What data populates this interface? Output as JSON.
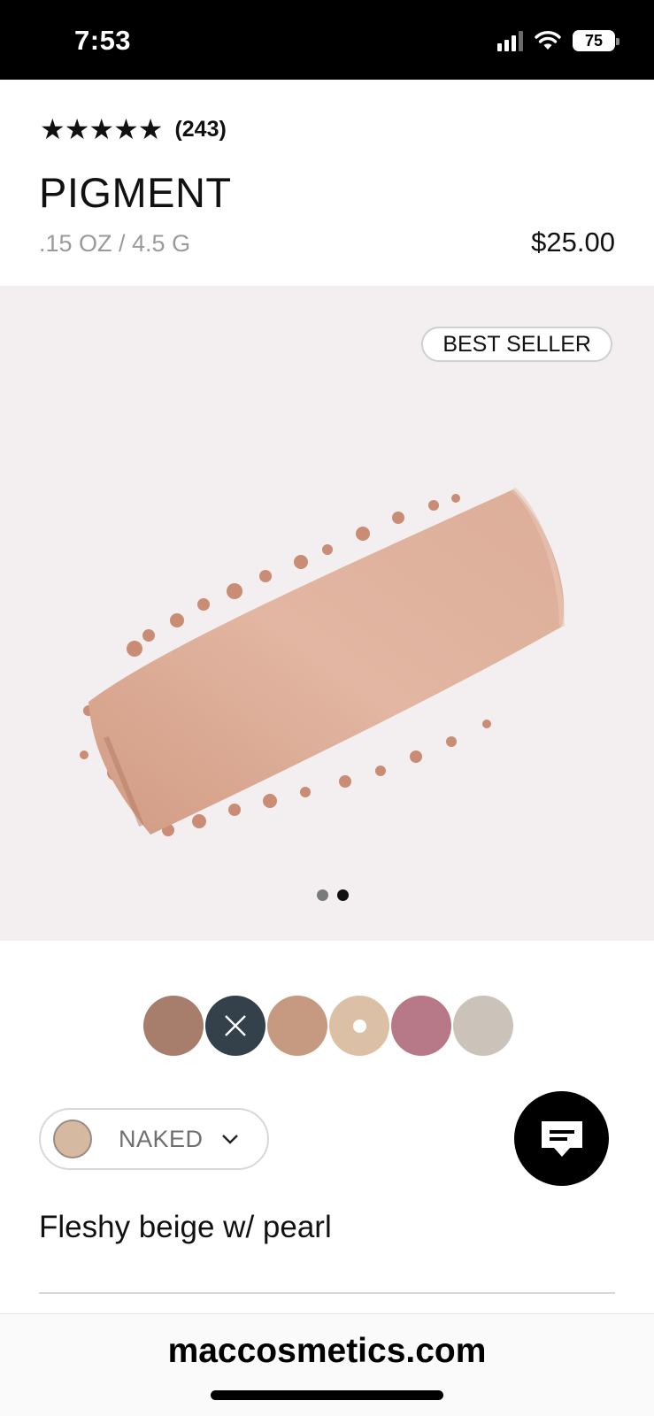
{
  "status_bar": {
    "time": "7:53",
    "battery": "75"
  },
  "product": {
    "stars": "★★★★★",
    "review_count": "(243)",
    "title": "PIGMENT",
    "size": ".15 OZ / 4.5 G",
    "price": "$25.00",
    "badge": "BEST SELLER"
  },
  "carousel": {
    "total_slides": 2,
    "active_slide": 2
  },
  "shades": {
    "swatches": [
      {
        "color": "#a77e6b",
        "state": "default"
      },
      {
        "color": "#34404a",
        "state": "sold-out"
      },
      {
        "color": "#c69a80",
        "state": "default"
      },
      {
        "color": "#dcc0a6",
        "state": "selected"
      },
      {
        "color": "#b77887",
        "state": "default"
      },
      {
        "color": "#cbc3b9",
        "state": "default"
      }
    ],
    "selected_name": "NAKED",
    "selected_color": "#d6b9a1",
    "description": "Fleshy beige w/ pearl"
  },
  "browser": {
    "url": "maccosmetics.com"
  },
  "colors": {
    "hero_bg": "#f3eff0",
    "powder": "#d6a48f",
    "dot_active": "#111111",
    "dot_inactive": "#7a7a7a"
  }
}
